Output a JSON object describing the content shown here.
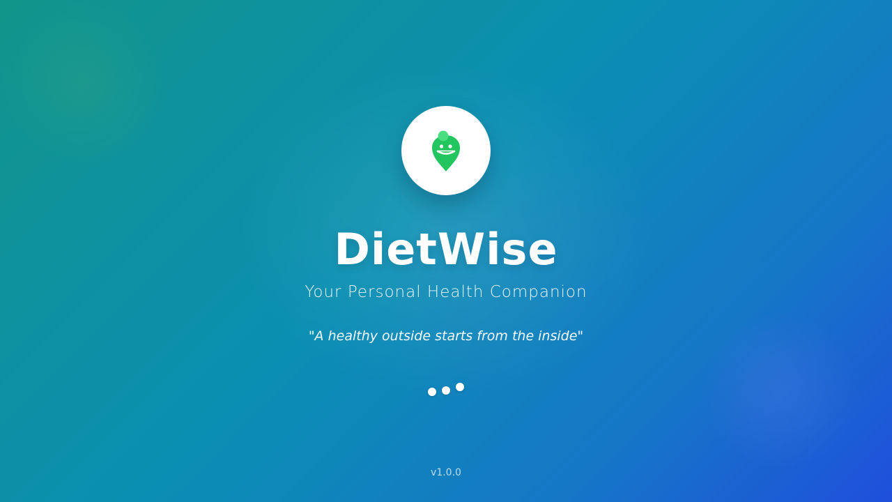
{
  "app": {
    "name": "DietWise",
    "tagline": "Your Personal Health Companion",
    "quote": "\"A healthy outside starts from the inside\"",
    "version": "v1.0.0"
  },
  "logo": {
    "icon": "smiling-leaf-pin-icon",
    "colors": {
      "leaf": "#22c55e",
      "leaf_highlight": "#4ade80",
      "background": "#ffffff"
    }
  },
  "loading_indicator": {
    "icon": "loading-dots",
    "dot_count": 3
  },
  "colors": {
    "gradient_start": "#12948a",
    "gradient_mid": "#0a8fb2",
    "gradient_end": "#1f4fdc",
    "text": "#ffffff"
  }
}
